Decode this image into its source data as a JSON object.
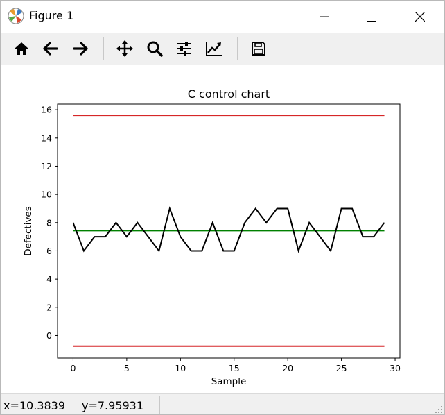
{
  "window": {
    "title": "Figure 1"
  },
  "toolbar": {
    "tools": [
      {
        "name": "home-icon"
      },
      {
        "name": "back-arrow-icon"
      },
      {
        "name": "forward-arrow-icon"
      },
      {
        "name": "pan-move-icon"
      },
      {
        "name": "zoom-magnifier-icon"
      },
      {
        "name": "configure-subplots-icon"
      },
      {
        "name": "edit-axis-icon"
      },
      {
        "name": "save-floppy-icon"
      }
    ]
  },
  "status": {
    "x": "x=10.3839",
    "y": "y=7.95931"
  },
  "colors": {
    "ucl": "#d62728",
    "lcl": "#d62728",
    "center": "#008000",
    "series": "#000000"
  },
  "chart_data": {
    "type": "line",
    "title": "C control chart",
    "xlabel": "Sample",
    "ylabel": "Defectives",
    "xlim": [
      -1.45,
      30.45
    ],
    "ylim": [
      -1.6,
      16.4
    ],
    "xticks": [
      0,
      5,
      10,
      15,
      20,
      25,
      30
    ],
    "yticks": [
      0,
      2,
      4,
      6,
      8,
      10,
      12,
      14,
      16
    ],
    "x": [
      0,
      1,
      2,
      3,
      4,
      5,
      6,
      7,
      8,
      9,
      10,
      11,
      12,
      13,
      14,
      15,
      16,
      17,
      18,
      19,
      20,
      21,
      22,
      23,
      24,
      25,
      26,
      27,
      28,
      29
    ],
    "values": [
      8,
      6,
      7,
      7,
      8,
      7,
      8,
      7,
      6,
      9,
      7,
      6,
      6,
      8,
      6,
      6,
      8,
      9,
      8,
      9,
      9,
      6,
      8,
      7,
      6,
      9,
      9,
      7,
      7,
      8
    ],
    "center_line": 7.43,
    "ucl": 15.61,
    "lcl": -0.75,
    "grid": false,
    "legend": "none"
  }
}
